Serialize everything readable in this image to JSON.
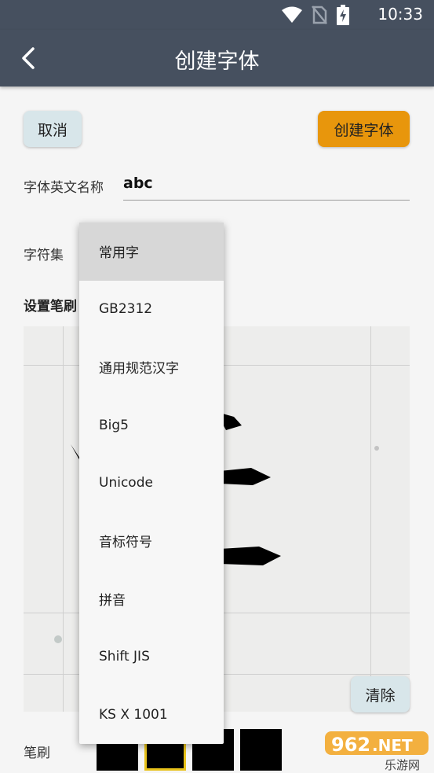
{
  "status_bar": {
    "time": "10:33"
  },
  "app_bar": {
    "title": "创建字体"
  },
  "actions": {
    "cancel_label": "取消",
    "create_label": "创建字体"
  },
  "form": {
    "font_name_label": "字体英文名称",
    "font_name_value": "abc",
    "charset_label": "字符集",
    "brush_section_title": "设置笔刷"
  },
  "charset_dropdown": {
    "selected": "常用字",
    "options": [
      "常用字",
      "GB2312",
      "通用规范汉字",
      "Big5",
      "Unicode",
      "音标符号",
      "拼音",
      "Shift JIS",
      "KS X 1001"
    ]
  },
  "canvas": {
    "clear_label": "清除"
  },
  "brush": {
    "label": "笔刷",
    "swatch_count": 4,
    "selected_index": 1
  },
  "watermark": {
    "text_top": "962",
    "text_net": ".NET",
    "text_bottom": "乐游网"
  },
  "colors": {
    "app_bar": "#46505f",
    "accent": "#e8960c",
    "secondary_button": "#d8e6ea",
    "swatch_highlight": "#e8c21a"
  }
}
